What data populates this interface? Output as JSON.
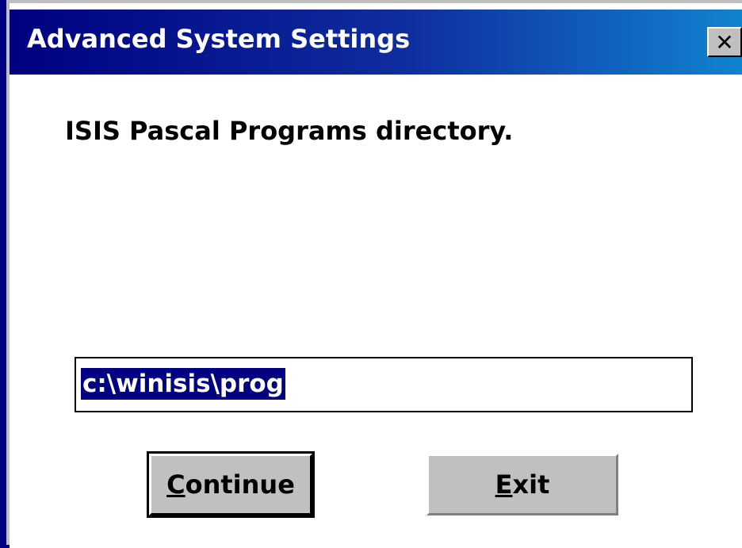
{
  "dialog": {
    "title": "Advanced System Settings",
    "close_glyph": "✕",
    "prompt": "ISIS Pascal Programs directory.",
    "path_value": "c:\\winisis\\prog",
    "continue_button": {
      "mnemonic": "C",
      "rest": "ontinue"
    },
    "exit_button": {
      "mnemonic": "E",
      "rest": "xit"
    }
  },
  "colors": {
    "titlebar": "#000080",
    "face": "#c0c0c0",
    "selection": "#000080"
  }
}
